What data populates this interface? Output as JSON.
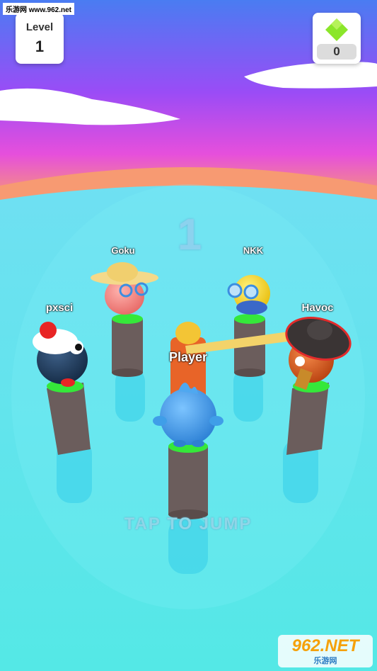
{
  "hud": {
    "level_label": "Level",
    "level_value": "1",
    "gem_count": "0",
    "gem_icon": "diamond-gem-icon",
    "gem_color": "#8be62a"
  },
  "countdown": "1",
  "players": [
    {
      "name": "Goku",
      "body_color": "#f47a78",
      "accessory": "straw-hat-and-glasses"
    },
    {
      "name": "NKK",
      "body_color": "#f4d21c",
      "accessory": "glasses"
    },
    {
      "name": "pxsci",
      "body_color": "#1e3a5e",
      "accessory": "sailor-cap"
    },
    {
      "name": "Havoc",
      "body_color": "#d9531a",
      "accessory": "wide-brim-hat"
    },
    {
      "name": "Player",
      "body_color": "#3f9ee8",
      "accessory": "none"
    }
  ],
  "tap_hint": "TAP TO JUMP",
  "watermark_top": "乐游网 www.962.net",
  "watermark_bottom": {
    "logo": "962.NET",
    "sub": "乐游网"
  },
  "colors": {
    "sky_top": "#4b7cf0",
    "sky_mid": "#c04cf6",
    "horizon": "#f5a070",
    "water": "#5de3ec",
    "pillar": "#6b5d5c",
    "pad": "#35e83a"
  }
}
